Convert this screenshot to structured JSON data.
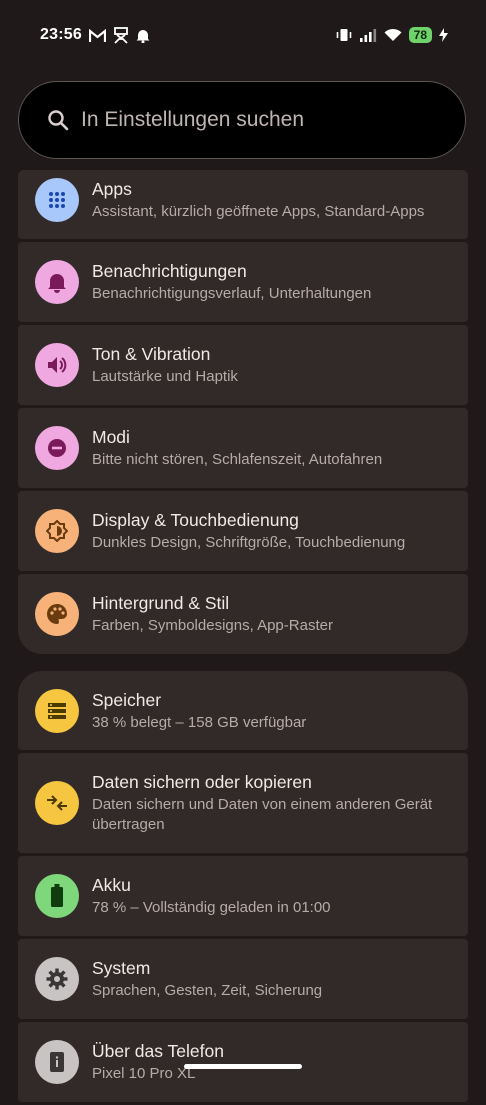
{
  "status": {
    "time": "23:56",
    "battery": "78",
    "left_icons": [
      "gmail-icon",
      "app-notification-icon",
      "bell-icon"
    ],
    "right_icons": [
      "vibrate-icon",
      "signal-icon",
      "wifi-icon",
      "battery-icon"
    ]
  },
  "search": {
    "placeholder": "In Einstellungen suchen"
  },
  "groups": [
    {
      "items": [
        {
          "title": "Apps",
          "subtitle": "Assistant, kürzlich geöffnete Apps, Standard-Apps",
          "icon": "apps-grid-icon",
          "color": "#a8c7fa"
        },
        {
          "title": "Benachrichtigungen",
          "subtitle": "Benachrichtigungsverlauf, Unterhaltungen",
          "icon": "bell-icon",
          "color": "#f0a8e0"
        },
        {
          "title": "Ton & Vibration",
          "subtitle": "Lautstärke und Haptik",
          "icon": "speaker-icon",
          "color": "#f0a8e0"
        },
        {
          "title": "Modi",
          "subtitle": "Bitte nicht stören, Schlafenszeit, Autofahren",
          "icon": "do-not-disturb-icon",
          "color": "#f0a8e0"
        },
        {
          "title": "Display & Touchbedienung",
          "subtitle": "Dunkles Design, Schriftgröße, Touchbedienung",
          "icon": "brightness-icon",
          "color": "#f7b27a"
        },
        {
          "title": "Hintergrund & Stil",
          "subtitle": "Farben, Symboldesigns, App-Raster",
          "icon": "palette-icon",
          "color": "#f7b27a"
        }
      ]
    },
    {
      "items": [
        {
          "title": "Speicher",
          "subtitle": "38 % belegt – 158 GB verfügbar",
          "icon": "storage-icon",
          "color": "#f6c640"
        },
        {
          "title": "Daten sichern oder kopieren",
          "subtitle": "Daten sichern und Daten von einem anderen Gerät übertragen",
          "icon": "transfer-icon",
          "color": "#f6c640"
        },
        {
          "title": "Akku",
          "subtitle": "78 % – Vollständig geladen in 01:00",
          "icon": "battery-icon",
          "color": "#7fd77c"
        },
        {
          "title": "System",
          "subtitle": "Sprachen, Gesten, Zeit, Sicherung",
          "icon": "gear-icon",
          "color": "#c8c4c3"
        },
        {
          "title": "Über das Telefon",
          "subtitle": "Pixel 10 Pro XL",
          "icon": "phone-info-icon",
          "color": "#c8c4c3"
        }
      ]
    }
  ]
}
